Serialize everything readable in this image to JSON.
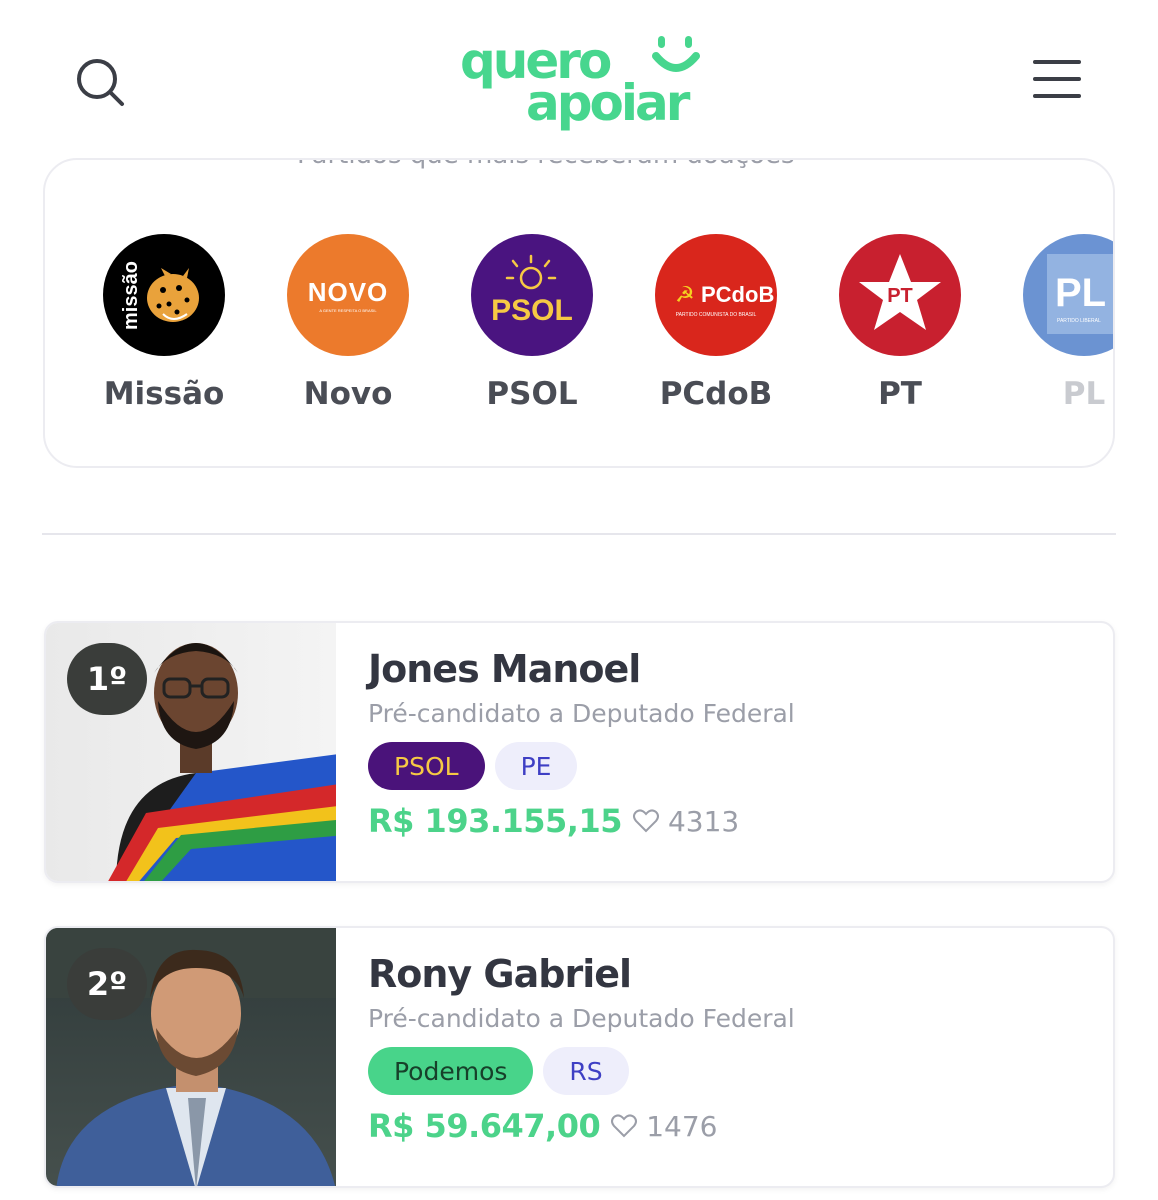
{
  "header": {
    "logo_line1": "quero",
    "logo_line2": "apoiar"
  },
  "parties_section": {
    "title": "Partidos que mais receberam doações",
    "parties": [
      {
        "name": "Missão",
        "logo_text": "missão",
        "color": "#000000"
      },
      {
        "name": "Novo",
        "logo_text": "NOVO",
        "logo_subtext": "A GENTE RESPEITA O BRASIL",
        "color": "#ec7a2c"
      },
      {
        "name": "PSOL",
        "logo_text": "PSOL",
        "color": "#4a1480"
      },
      {
        "name": "PCdoB",
        "logo_text": "PCdoB",
        "logo_subtext": "PARTIDO COMUNISTA DO BRASIL",
        "color": "#d9261c"
      },
      {
        "name": "PT",
        "logo_text": "PT",
        "color": "#c8202f"
      },
      {
        "name": "PL",
        "logo_text": "PL",
        "logo_subtext": "PARTIDO LIBERAL",
        "color": "#3a6fc4"
      }
    ]
  },
  "candidates": [
    {
      "rank": "1º",
      "name": "Jones Manoel",
      "role": "Pré-candidato a Deputado Federal",
      "party": "PSOL",
      "party_bg": "#4a137a",
      "party_fg": "#f6c944",
      "state": "PE",
      "amount": "R$ 193.155,15",
      "likes": "4313"
    },
    {
      "rank": "2º",
      "name": "Rony Gabriel",
      "role": "Pré-candidato a Deputado Federal",
      "party": "Podemos",
      "party_bg": "#48d48a",
      "party_fg": "#17402a",
      "state": "RS",
      "amount": "R$ 59.647,00",
      "likes": "1476"
    }
  ],
  "colors": {
    "brand_green": "#47d68e",
    "state_tag_bg": "#eeeefb",
    "state_tag_fg": "#3e3fc4"
  }
}
